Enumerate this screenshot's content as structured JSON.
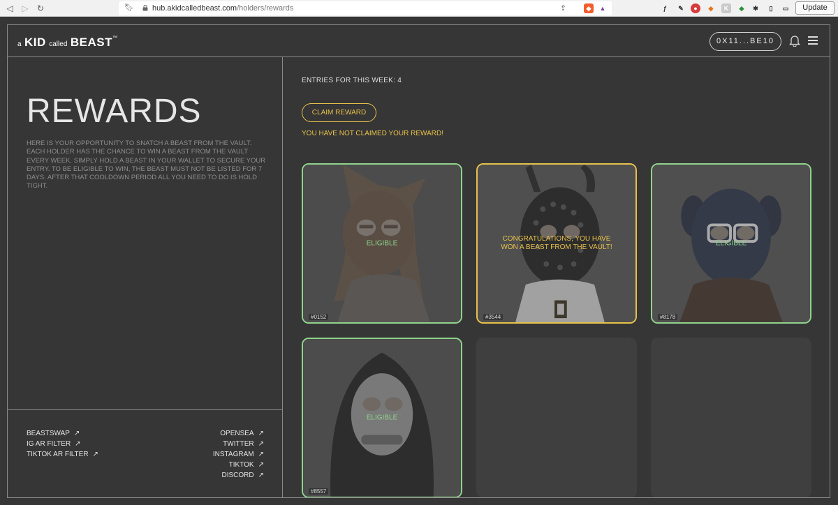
{
  "browser": {
    "url_host": "hub.akidcalledbeast.com",
    "url_path": "/holders/rewards",
    "update_label": "Update"
  },
  "header": {
    "logo": {
      "a": "a",
      "kid": "KID",
      "called": "called",
      "beast": "BEAST",
      "tm": "™"
    },
    "wallet": "0X11...BE10"
  },
  "left": {
    "title": "REWARDS",
    "description": "HERE IS YOUR OPPORTUNITY TO SNATCH A BEAST FROM THE VAULT. EACH HOLDER HAS THE CHANCE TO WIN A BEAST FROM THE VAULT EVERY WEEK. SIMPLY HOLD A BEAST IN YOUR WALLET TO SECURE YOUR ENTRY. TO BE ELIGIBLE TO WIN, THE BEAST MUST NOT BE LISTED FOR 7 DAYS. AFTER THAT COOLDOWN PERIOD ALL YOU NEED TO DO IS HOLD TIGHT.",
    "links_left": [
      {
        "label": "BEASTSWAP"
      },
      {
        "label": "IG AR FILTER"
      },
      {
        "label": "TIKTOK AR FILTER"
      }
    ],
    "links_right": [
      {
        "label": "OPENSEA"
      },
      {
        "label": "TWITTER"
      },
      {
        "label": "INSTAGRAM"
      },
      {
        "label": "TIKTOK"
      },
      {
        "label": "DISCORD"
      }
    ],
    "arrow": "↗"
  },
  "main": {
    "entries": "ENTRIES FOR THIS WEEK: 4",
    "claim_button": "CLAIM REWARD",
    "notice": "YOU HAVE NOT CLAIMED YOUR REWARD!",
    "cards": [
      {
        "id": "#0152",
        "status": "ELIGIBLE",
        "state": "eligible"
      },
      {
        "id": "#3544",
        "status": "CONGRATULATIONS, YOU HAVE WON A BEAST FROM THE VAULT!",
        "state": "won"
      },
      {
        "id": "#8178",
        "status": "ELIGIBLE",
        "state": "eligible"
      },
      {
        "id": "#8557",
        "status": "ELIGIBLE",
        "state": "eligible"
      }
    ]
  },
  "colors": {
    "background": "#363636",
    "eligible": "#8fd38b",
    "gold": "#e8c14a"
  }
}
